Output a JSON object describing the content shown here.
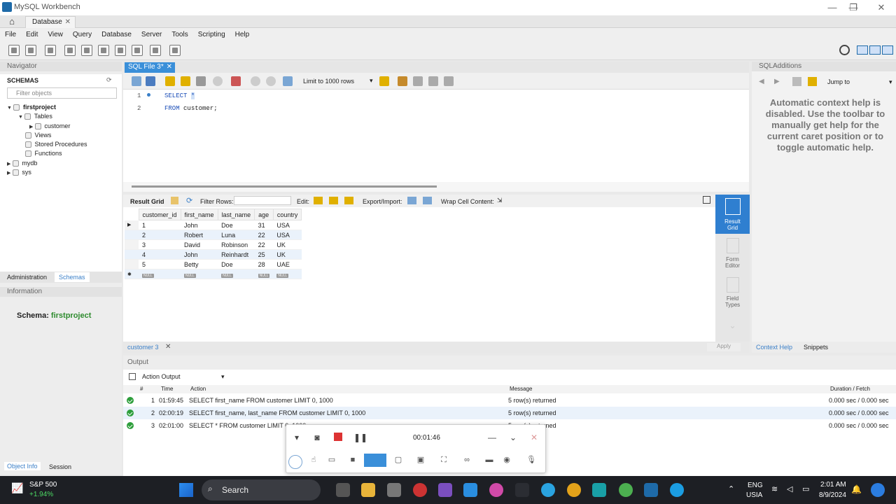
{
  "window": {
    "title": "MySQL Workbench",
    "min": "—",
    "max": "❐",
    "close": "✕"
  },
  "tabs": {
    "home_icon": "house-icon",
    "database_tab": "Database",
    "close": "✕"
  },
  "menu": [
    "File",
    "Edit",
    "View",
    "Query",
    "Database",
    "Server",
    "Tools",
    "Scripting",
    "Help"
  ],
  "navigator": {
    "header": "Navigator",
    "schemas_title": "SCHEMAS",
    "filter_placeholder": "Filter objects",
    "tree": {
      "firstproject": "firstproject",
      "tables": "Tables",
      "customer": "customer",
      "views": "Views",
      "stored_procedures": "Stored Procedures",
      "functions": "Functions",
      "mydb": "mydb",
      "sys": "sys"
    },
    "tab_admin": "Administration",
    "tab_schemas": "Schemas",
    "info_header": "Information",
    "schema_label": "Schema:",
    "schema_value": "firstproject",
    "tab_object_info": "Object Info",
    "tab_session": "Session"
  },
  "editor": {
    "tab": "SQL File 3*",
    "limit": "Limit to 1000 rows",
    "lines": [
      {
        "num": "1",
        "kw": "SELECT",
        "rest": "*"
      },
      {
        "num": "2",
        "kw": "FROM",
        "rest": "customer;"
      }
    ]
  },
  "result": {
    "toolbar": {
      "grid": "Result Grid",
      "filter": "Filter Rows:",
      "edit": "Edit:",
      "export": "Export/Import:",
      "wrap": "Wrap Cell Content:"
    },
    "columns": [
      "customer_id",
      "first_name",
      "last_name",
      "age",
      "country"
    ],
    "rows": [
      [
        "1",
        "John",
        "Doe",
        "31",
        "USA"
      ],
      [
        "2",
        "Robert",
        "Luna",
        "22",
        "USA"
      ],
      [
        "3",
        "David",
        "Robinson",
        "22",
        "UK"
      ],
      [
        "4",
        "John",
        "Reinhardt",
        "25",
        "UK"
      ],
      [
        "5",
        "Betty",
        "Doe",
        "28",
        "UAE"
      ]
    ],
    "null_label": "NULL",
    "side": {
      "result_grid_1": "Result",
      "result_grid_2": "Grid",
      "form_editor_1": "Form",
      "form_editor_2": "Editor",
      "field_types_1": "Field",
      "field_types_2": "Types"
    },
    "tab_label": "customer 3",
    "apply": "Apply"
  },
  "sqladditions": {
    "header": "SQLAdditions",
    "jump": "Jump to",
    "help": "Automatic context help is disabled. Use the toolbar to manually get help for the current caret position or to toggle automatic help.",
    "tab_context": "Context Help",
    "tab_snippets": "Snippets"
  },
  "output": {
    "header": "Output",
    "selector": "Action Output",
    "columns": {
      "num": "#",
      "time": "Time",
      "action": "Action",
      "message": "Message",
      "duration": "Duration / Fetch"
    },
    "rows": [
      {
        "num": "1",
        "time": "01:59:45",
        "action": "SELECT first_name FROM customer LIMIT 0, 1000",
        "message": "5 row(s) returned",
        "duration": "0.000 sec / 0.000 sec"
      },
      {
        "num": "2",
        "time": "02:00:19",
        "action": "SELECT first_name, last_name FROM customer LIMIT 0, 1000",
        "message": "5 row(s) returned",
        "duration": "0.000 sec / 0.000 sec"
      },
      {
        "num": "3",
        "time": "02:01:00",
        "action": "SELECT * FROM customer LIMIT 0, 1000",
        "message": "5 row(s) returned",
        "duration": "0.000 sec / 0.000 sec"
      }
    ]
  },
  "recorder": {
    "time": "00:01:46"
  },
  "taskbar": {
    "stock_name": "S&P 500",
    "stock_change": "+1.94%",
    "search": "Search",
    "lang1": "ENG",
    "lang2": "USIA",
    "time": "2:01 AM",
    "date": "8/9/2024",
    "accent": "#1d1f24"
  }
}
